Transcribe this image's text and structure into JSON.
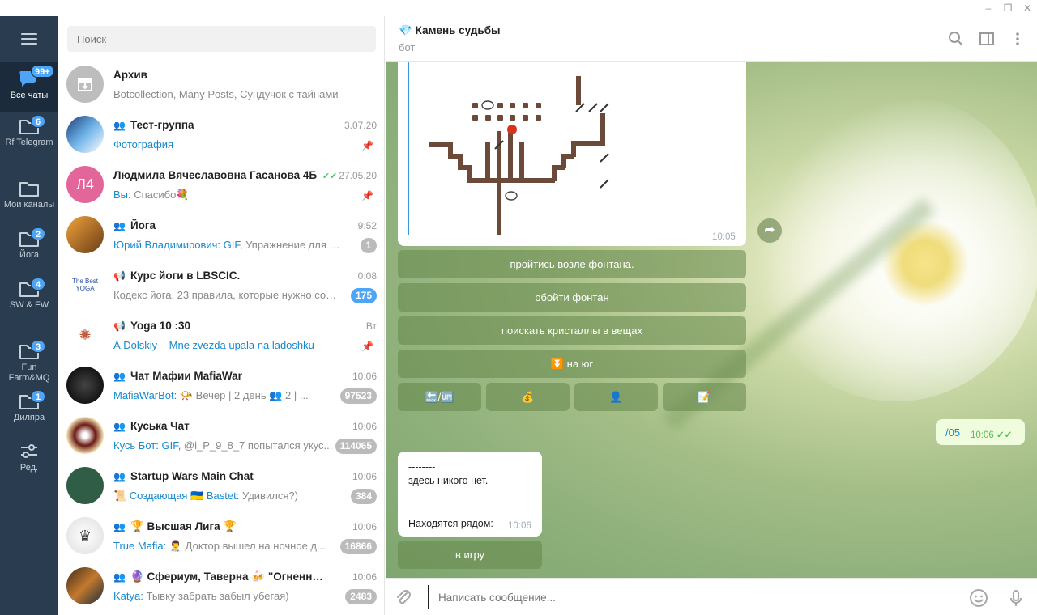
{
  "colors": {
    "sidebar": "#2a3c4f",
    "accent": "#4ea4f5",
    "link": "#168acd",
    "bubble_out": "#effdde"
  },
  "window": {
    "minimize": "–",
    "restore": "❐",
    "close": "✕"
  },
  "folders": [
    {
      "label": "Все чаты",
      "badge": "99+",
      "icon": "chats-icon",
      "active": true
    },
    {
      "label": "Rf Telegram",
      "badge": "6",
      "icon": "folder-icon"
    },
    {
      "label": "Мои каналы",
      "badge": "",
      "icon": "folder-icon"
    },
    {
      "label": "Йога",
      "badge": "2",
      "icon": "folder-icon"
    },
    {
      "label": "SW & FW",
      "badge": "4",
      "icon": "folder-icon"
    },
    {
      "label": "Fun Farm&MQ",
      "badge": "3",
      "icon": "folder-icon"
    },
    {
      "label": "Диляра",
      "badge": "1",
      "icon": "folder-icon"
    },
    {
      "label": "Ред.",
      "badge": "",
      "icon": "edit-sliders-icon"
    }
  ],
  "search": {
    "placeholder": "Поиск"
  },
  "chats": [
    {
      "name": "Архив",
      "time": "",
      "from": "",
      "preview": "Botcollection, Many Posts, Сундучок с тайнами",
      "badge": "",
      "pinned": false,
      "group": ""
    },
    {
      "name": "Тест-группа",
      "time": "3.07.20",
      "from": "Фотография",
      "preview": "",
      "badge": "",
      "pinned": true,
      "group": "👥"
    },
    {
      "name": "Людмила Вячеславовна Гасанова 4Б",
      "time": "27.05.20",
      "checks": "✔✔",
      "from": "Вы:",
      "preview": " Спасибо💐",
      "badge": "",
      "pinned": true,
      "group": ""
    },
    {
      "name": "Йога",
      "time": "9:52",
      "from": "Юрий Владимирович: GIF,",
      "preview": " Упражнение для ра...",
      "badge": "1",
      "pinned": false,
      "group": "👥"
    },
    {
      "name": "Курс йоги в LBSCIC.",
      "time": "0:08",
      "from": "",
      "preview": "Кодекс йога. 23 правила, которые нужно соб...",
      "badge": "175",
      "badge_blue": true,
      "pinned": false,
      "group": "📢"
    },
    {
      "name": "Yoga 10 :30",
      "time": "Вт",
      "from": "A.Dolskiy – Mne zvezda upala na ladoshku",
      "preview": "",
      "badge": "",
      "pinned": true,
      "group": "📢"
    },
    {
      "name": "Чат Мафии MafiaWar",
      "time": "10:06",
      "from": "MafiaWarBot:",
      "preview": " 📯 Вечер | 2 день 👥 2 | ...",
      "badge": "97523",
      "pinned": false,
      "group": "👥"
    },
    {
      "name": "Куська Чат",
      "time": "10:06",
      "from": "Кусь Бот: GIF,",
      "preview": " @i_P_9_8_7 попытался укус...",
      "badge": "114065",
      "pinned": false,
      "group": "👥"
    },
    {
      "name": "Startup Wars Main Chat",
      "time": "10:06",
      "from": "📜 Создающая 🇺🇦 Bastet:",
      "preview": " Удивился?)",
      "badge": "384",
      "pinned": false,
      "group": "👥"
    },
    {
      "name": "🏆 Высшая Лига 🏆",
      "time": "10:06",
      "from": "True Mafia:",
      "preview": " 👨‍⚕️ Доктор вышел на ночное д...",
      "badge": "16866",
      "pinned": false,
      "group": "👥"
    },
    {
      "name": "🔮 Сфериум, Таверна 🍻 \"Огненный д...",
      "time": "10:06",
      "from": "Katya:",
      "preview": " Тывку забрать забыл убегая)",
      "badge": "2483",
      "pinned": false,
      "group": "👥"
    }
  ],
  "header": {
    "title": "💎 Камень судьбы",
    "subtitle": "бот"
  },
  "messages": {
    "image_time": "10:05",
    "buttons": [
      "пройтись возле фонтана.",
      "обойти фонтан",
      "поискать кристаллы в вещах",
      "⏬ на юг"
    ],
    "small_buttons": [
      "🔙/🆙",
      "💰",
      "👤",
      "📝"
    ],
    "out_text": "/05",
    "out_time": "10:06",
    "out_checks": "✔✔",
    "in_lines": [
      "--------",
      "здесь никого нет.",
      "Находятся рядом:"
    ],
    "in_time": "10:06",
    "game_button": "в игру"
  },
  "composer": {
    "placeholder": "Написать сообщение..."
  }
}
